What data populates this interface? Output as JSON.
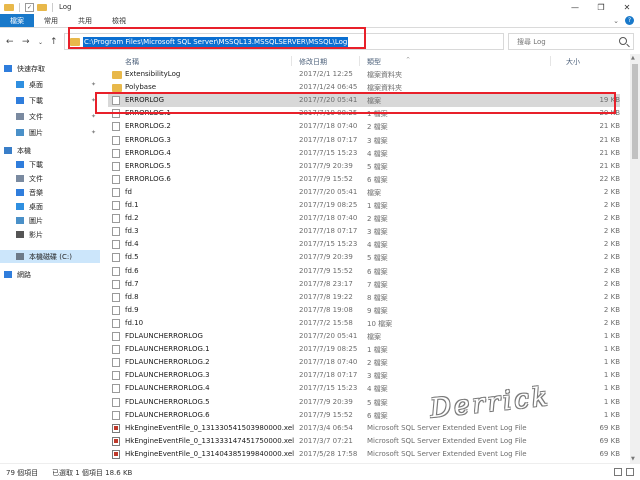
{
  "window": {
    "title": "Log",
    "minimize_glyph": "—",
    "maximize_glyph": "❐",
    "close_glyph": "✕"
  },
  "ribbon": {
    "tabs": [
      "檔案",
      "常用",
      "共用",
      "檢視"
    ],
    "expand_glyph": "⌄",
    "help_glyph": "?"
  },
  "nav_buttons": {
    "back": "←",
    "forward": "→",
    "dropdown": "⌄",
    "up": "↑"
  },
  "address": {
    "path": "C:\\Program Files\\Microsoft SQL Server\\MSSQL13.MSSQLSERVER\\MSSQL\\Log",
    "dropdown": "⌄",
    "refresh": "↻"
  },
  "search": {
    "placeholder": "搜尋 Log"
  },
  "sidebar": {
    "items": [
      {
        "label": "快速存取",
        "icon": "star-icon",
        "color": "#2f7ddc"
      },
      {
        "label": "桌面",
        "icon": "desktop-icon",
        "color": "#2f8fe0",
        "pinned": true
      },
      {
        "label": "下載",
        "icon": "download-icon",
        "color": "#2f7ddc",
        "pinned": true
      },
      {
        "label": "文件",
        "icon": "document-icon",
        "color": "#7a8aa0",
        "pinned": true
      },
      {
        "label": "圖片",
        "icon": "picture-icon",
        "color": "#4a90c8",
        "pinned": true
      },
      {
        "label": "本機",
        "icon": "computer-icon",
        "color": "#3a7ec8"
      },
      {
        "label": "下載",
        "icon": "download-icon",
        "color": "#2f7ddc"
      },
      {
        "label": "文件",
        "icon": "document-icon",
        "color": "#7a8aa0"
      },
      {
        "label": "音樂",
        "icon": "music-icon",
        "color": "#2f7ddc"
      },
      {
        "label": "桌面",
        "icon": "desktop-icon",
        "color": "#2f8fe0"
      },
      {
        "label": "圖片",
        "icon": "picture-icon",
        "color": "#4a90c8"
      },
      {
        "label": "影片",
        "icon": "video-icon",
        "color": "#555555"
      },
      {
        "label": "本機磁碟 (C:)",
        "icon": "drive-icon",
        "color": "#6d7a88",
        "selected": true
      },
      {
        "label": "網路",
        "icon": "network-icon",
        "color": "#2f7ddc"
      }
    ]
  },
  "columns": {
    "name": "名稱",
    "date": "修改日期",
    "type": "類型",
    "size": "大小"
  },
  "files": [
    {
      "name": "ExtensibilityLog",
      "date": "2017/2/1 12:25",
      "type": "檔案資料夾",
      "size": "",
      "kind": "folder"
    },
    {
      "name": "Polybase",
      "date": "2017/1/24 06:45",
      "type": "檔案資料夾",
      "size": "",
      "kind": "folder"
    },
    {
      "name": "ERRORLOG",
      "date": "2017/7/20 05:41",
      "type": "檔案",
      "size": "19 KB",
      "kind": "file",
      "selected": true
    },
    {
      "name": "ERRORLOG.1",
      "date": "2017/7/19 08:25",
      "type": "1 檔案",
      "size": "20 KB",
      "kind": "file"
    },
    {
      "name": "ERRORLOG.2",
      "date": "2017/7/18 07:40",
      "type": "2 檔案",
      "size": "21 KB",
      "kind": "file"
    },
    {
      "name": "ERRORLOG.3",
      "date": "2017/7/18 07:17",
      "type": "3 檔案",
      "size": "21 KB",
      "kind": "file"
    },
    {
      "name": "ERRORLOG.4",
      "date": "2017/7/15 15:23",
      "type": "4 檔案",
      "size": "21 KB",
      "kind": "file"
    },
    {
      "name": "ERRORLOG.5",
      "date": "2017/7/9 20:39",
      "type": "5 檔案",
      "size": "21 KB",
      "kind": "file"
    },
    {
      "name": "ERRORLOG.6",
      "date": "2017/7/9 15:52",
      "type": "6 檔案",
      "size": "22 KB",
      "kind": "file"
    },
    {
      "name": "fd",
      "date": "2017/7/20 05:41",
      "type": "檔案",
      "size": "2 KB",
      "kind": "file"
    },
    {
      "name": "fd.1",
      "date": "2017/7/19 08:25",
      "type": "1 檔案",
      "size": "2 KB",
      "kind": "file"
    },
    {
      "name": "fd.2",
      "date": "2017/7/18 07:40",
      "type": "2 檔案",
      "size": "2 KB",
      "kind": "file"
    },
    {
      "name": "fd.3",
      "date": "2017/7/18 07:17",
      "type": "3 檔案",
      "size": "2 KB",
      "kind": "file"
    },
    {
      "name": "fd.4",
      "date": "2017/7/15 15:23",
      "type": "4 檔案",
      "size": "2 KB",
      "kind": "file"
    },
    {
      "name": "fd.5",
      "date": "2017/7/9 20:39",
      "type": "5 檔案",
      "size": "2 KB",
      "kind": "file"
    },
    {
      "name": "fd.6",
      "date": "2017/7/9 15:52",
      "type": "6 檔案",
      "size": "2 KB",
      "kind": "file"
    },
    {
      "name": "fd.7",
      "date": "2017/7/8 23:17",
      "type": "7 檔案",
      "size": "2 KB",
      "kind": "file"
    },
    {
      "name": "fd.8",
      "date": "2017/7/8 19:22",
      "type": "8 檔案",
      "size": "2 KB",
      "kind": "file"
    },
    {
      "name": "fd.9",
      "date": "2017/7/8 19:08",
      "type": "9 檔案",
      "size": "2 KB",
      "kind": "file"
    },
    {
      "name": "fd.10",
      "date": "2017/7/2 15:58",
      "type": "10 檔案",
      "size": "2 KB",
      "kind": "file"
    },
    {
      "name": "FDLAUNCHERRORLOG",
      "date": "2017/7/20 05:41",
      "type": "檔案",
      "size": "1 KB",
      "kind": "file"
    },
    {
      "name": "FDLAUNCHERRORLOG.1",
      "date": "2017/7/19 08:25",
      "type": "1 檔案",
      "size": "1 KB",
      "kind": "file"
    },
    {
      "name": "FDLAUNCHERRORLOG.2",
      "date": "2017/7/18 07:40",
      "type": "2 檔案",
      "size": "1 KB",
      "kind": "file"
    },
    {
      "name": "FDLAUNCHERRORLOG.3",
      "date": "2017/7/18 07:17",
      "type": "3 檔案",
      "size": "1 KB",
      "kind": "file"
    },
    {
      "name": "FDLAUNCHERRORLOG.4",
      "date": "2017/7/15 15:23",
      "type": "4 檔案",
      "size": "1 KB",
      "kind": "file"
    },
    {
      "name": "FDLAUNCHERRORLOG.5",
      "date": "2017/7/9 20:39",
      "type": "5 檔案",
      "size": "1 KB",
      "kind": "file"
    },
    {
      "name": "FDLAUNCHERRORLOG.6",
      "date": "2017/7/9 15:52",
      "type": "6 檔案",
      "size": "1 KB",
      "kind": "file"
    },
    {
      "name": "HkEngineEventFile_0_131330541503980000.xel",
      "date": "2017/3/4 06:54",
      "type": "Microsoft SQL Server Extended Event Log File",
      "size": "69 KB",
      "kind": "xel"
    },
    {
      "name": "HkEngineEventFile_0_131333147451750000.xel",
      "date": "2017/3/7 07:21",
      "type": "Microsoft SQL Server Extended Event Log File",
      "size": "69 KB",
      "kind": "xel"
    },
    {
      "name": "HkEngineEventFile_0_131404385199840000.xel",
      "date": "2017/5/28 17:58",
      "type": "Microsoft SQL Server Extended Event Log File",
      "size": "69 KB",
      "kind": "xel"
    }
  ],
  "watermark": "Derrick",
  "status": {
    "item_count": "79 個項目",
    "selected": "已選取 1 個項目 18.6 KB"
  }
}
